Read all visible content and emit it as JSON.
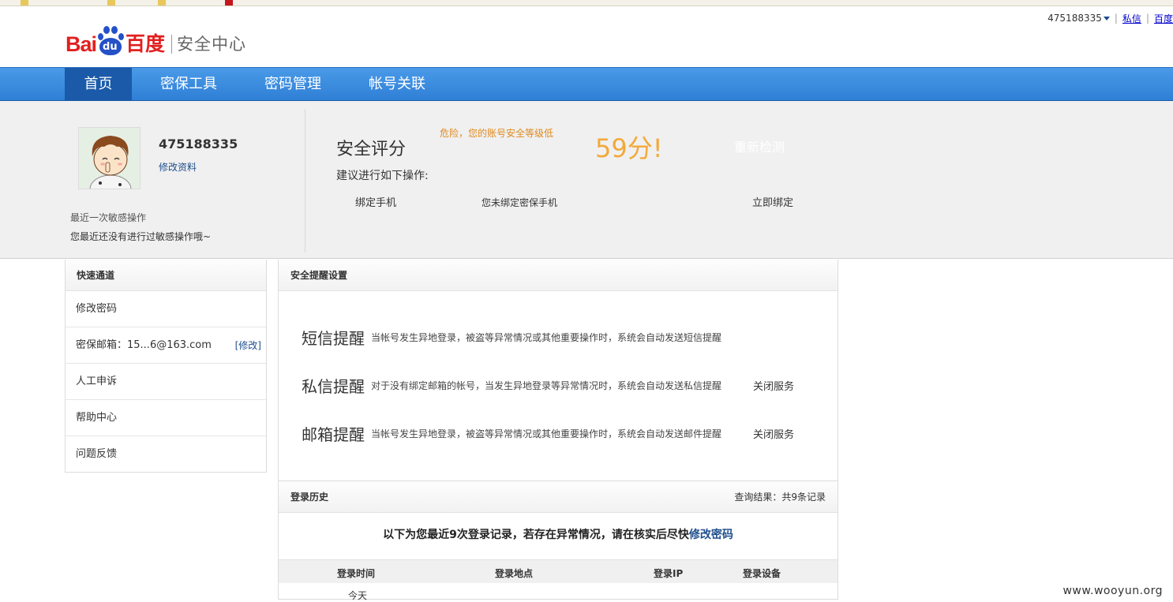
{
  "header": {
    "username": "475188335",
    "links": [
      "私信",
      "百度"
    ],
    "logo_text": {
      "bai": "Bai",
      "du": "du",
      "baidu_cn": "百度",
      "center": "安全中心"
    }
  },
  "nav": {
    "items": [
      "首页",
      "密保工具",
      "密码管理",
      "帐号关联"
    ],
    "active": 0
  },
  "profile": {
    "name": "475188335",
    "edit_link": "修改资料",
    "recent_title": "最近一次敏感操作",
    "recent_text": "您最近还没有进行过敏感操作哦~"
  },
  "security": {
    "label": "安全评分",
    "warning": "危险，您的账号安全等级低",
    "score": "59分!",
    "recheck": "重新检测",
    "suggest": "建议进行如下操作:",
    "action_name": "绑定手机",
    "action_status": "您未绑定密保手机",
    "action_button": "立即绑定",
    "colors": {
      "warning": "#e08a1e",
      "score": "#f2a93a"
    }
  },
  "sidebar": {
    "title": "快速通道",
    "items": [
      {
        "label": "修改密码"
      },
      {
        "label": "密保邮箱：15...6@163.com",
        "extra": "[修改]"
      },
      {
        "label": "人工申诉"
      },
      {
        "label": "帮助中心"
      },
      {
        "label": "问题反馈"
      }
    ]
  },
  "reminders": {
    "title": "安全提醒设置",
    "items": [
      {
        "title": "短信提醒",
        "desc": "当帐号发生异地登录，被盗等异常情况或其他重要操作时，系统会自动发送短信提醒",
        "action": ""
      },
      {
        "title": "私信提醒",
        "desc": "对于没有绑定邮箱的帐号，当发生异地登录等异常情况时，系统会自动发送私信提醒",
        "action": "关闭服务"
      },
      {
        "title": "邮箱提醒",
        "desc": "当帐号发生异地登录，被盗等异常情况或其他重要操作时，系统会自动发送邮件提醒",
        "action": "关闭服务"
      }
    ]
  },
  "history": {
    "title": "登录历史",
    "result": "查询结果：共9条记录",
    "message_prefix": "以下为您最近9次登录记录，若存在异常情况，请在核实后尽快",
    "message_link": "修改密码",
    "columns": [
      "登录时间",
      "登录地点",
      "登录IP",
      "登录设备"
    ],
    "first_row_time": "今天"
  },
  "watermark": "www.wooyun.org",
  "brand_colors": {
    "nav": "#2f7fd6",
    "nav_active": "#1b5aa8",
    "logo_red": "#e21f1f",
    "logo_blue": "#2450c8"
  }
}
